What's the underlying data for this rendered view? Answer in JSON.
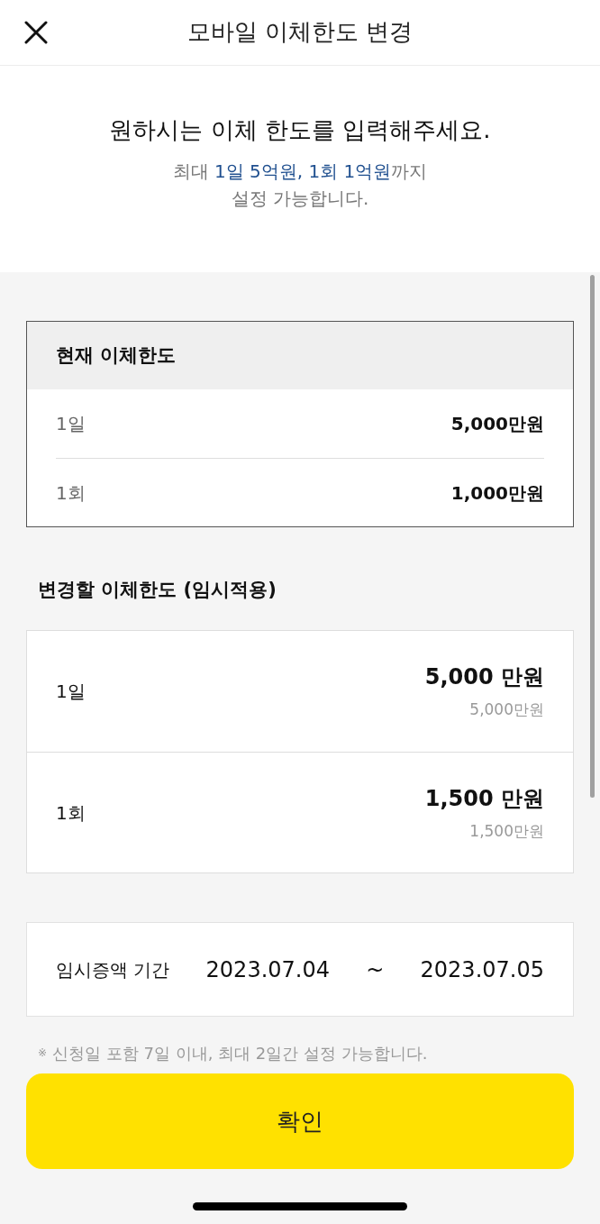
{
  "header": {
    "title": "모바일 이체한도 변경"
  },
  "intro": {
    "heading": "원하시는 이체 한도를 입력해주세요.",
    "note_lines": [
      [
        {
          "text": "최대 ",
          "highlight": false
        },
        {
          "text": "1일 5억원, 1회 1억원",
          "highlight": true
        },
        {
          "text": "까지",
          "highlight": false
        }
      ],
      [
        {
          "text": "설정 가능합니다.",
          "highlight": false
        }
      ]
    ]
  },
  "current_limit": {
    "title": "현재 이체한도",
    "rows": [
      {
        "label": "1일",
        "value": "5,000만원"
      },
      {
        "label": "1회",
        "value": "1,000만원"
      }
    ]
  },
  "new_limit": {
    "title": "변경할 이체한도 (임시적용)",
    "rows": [
      {
        "label": "1일",
        "amount": "5,000 만원",
        "converted": "5,000만원"
      },
      {
        "label": "1회",
        "amount": "1,500 만원",
        "converted": "1,500만원"
      }
    ]
  },
  "period": {
    "label": "임시증액 기간",
    "start": "2023.07.04",
    "separator": "~",
    "end": "2023.07.05"
  },
  "notice": {
    "mark": "※",
    "text": "신청일 포함 7일 이내, 최대 2일간 설정 가능합니다."
  },
  "confirm_button": "확인"
}
